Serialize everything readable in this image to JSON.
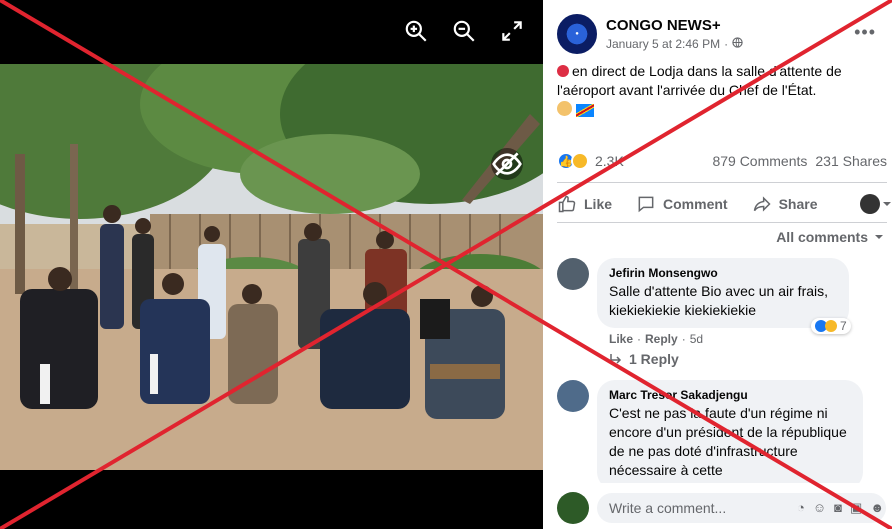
{
  "viewer": {
    "tools": [
      "zoom-in-icon",
      "zoom-out-icon",
      "fullscreen-icon"
    ]
  },
  "post": {
    "page_name": "CONGO NEWS+",
    "timestamp": "January 5 at 2:46 PM",
    "separator": "·",
    "text": "en direct de Lodja dans la salle d'attente de l'aéroport avant l'arrivée du Chef de l'État.",
    "reaction_count": "2.3K",
    "comments_count": "879 Comments",
    "shares_count": "231 Shares"
  },
  "actions": {
    "like": "Like",
    "comment": "Comment",
    "share": "Share"
  },
  "comments_filter": "All comments",
  "comments": [
    {
      "author": "Jefirin Monsengwo",
      "text": "Salle d'attente Bio avec un air frais, kiekiekiekie kiekiekiekie",
      "like": "Like",
      "reply": "Reply",
      "age": "5d",
      "reactions": "7",
      "replies": "1 Reply"
    },
    {
      "author": "Marc Tresor Sakadjengu",
      "text": "C'est ne pas la faute d'un régime ni encore d'un président de la république de ne pas doté d'infrastructure nécessaire à cette"
    }
  ],
  "composer": {
    "placeholder": "Write a comment..."
  },
  "colors": {
    "accent": "#1877f2",
    "overlay_x": "#e0242f"
  }
}
